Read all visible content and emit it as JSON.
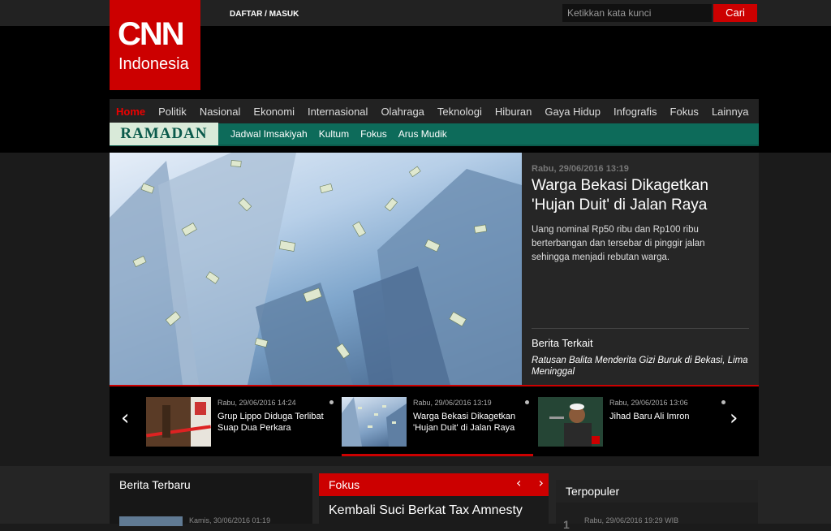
{
  "header": {
    "logo_text": "CNN",
    "logo_sub": "Indonesia",
    "auth_link": "DAFTAR / MASUK",
    "search_placeholder": "Ketikkan kata kunci",
    "search_button": "Cari"
  },
  "nav": {
    "items": [
      "Home",
      "Politik",
      "Nasional",
      "Ekonomi",
      "Internasional",
      "Olahraga",
      "Teknologi",
      "Hiburan",
      "Gaya Hidup",
      "Infografis",
      "Fokus",
      "Lainnya"
    ]
  },
  "ramadan": {
    "tag": "RAMADAN",
    "items": [
      "Jadwal Imsakiyah",
      "Kultum",
      "Fokus",
      "Arus Mudik"
    ]
  },
  "hero": {
    "date": "Rabu, 29/06/2016 13:19",
    "title": "Warga Bekasi Dikagetkan 'Hujan Duit' di Jalan Raya",
    "description": "Uang nominal Rp50 ribu dan Rp100 ribu berterbangan dan tersebar di pinggir jalan sehingga menjadi rebutan warga.",
    "related_label": "Berita Terkait",
    "related_item": "Ratusan Balita Menderita Gizi Buruk di Bekasi, Lima Meninggal"
  },
  "carousel": {
    "prev_icon": "chevron-left-icon",
    "next_icon": "chevron-right-icon",
    "items": [
      {
        "date": "Rabu, 29/06/2016 14:24",
        "title": "Grup Lippo Diduga Terlibat Suap Dua Perkara"
      },
      {
        "date": "Rabu, 29/06/2016 13:19",
        "title": "Warga Bekasi Dikagetkan 'Hujan Duit' di Jalan Raya"
      },
      {
        "date": "Rabu, 29/06/2016 13:06",
        "title": "Jihad Baru Ali Imron"
      }
    ]
  },
  "sections": {
    "terbaru": {
      "title": "Berita Terbaru",
      "first_date": "Kamis, 30/06/2016 01:19"
    },
    "fokus": {
      "title": "Fokus",
      "first_title": "Kembali Suci Berkat Tax Amnesty"
    },
    "terpopuler": {
      "title": "Terpopuler",
      "first_date": "Rabu, 29/06/2016 19:29 WIB"
    }
  },
  "colors": {
    "brand_red": "#cc0000",
    "ramadan_green": "#0d6b5a"
  }
}
